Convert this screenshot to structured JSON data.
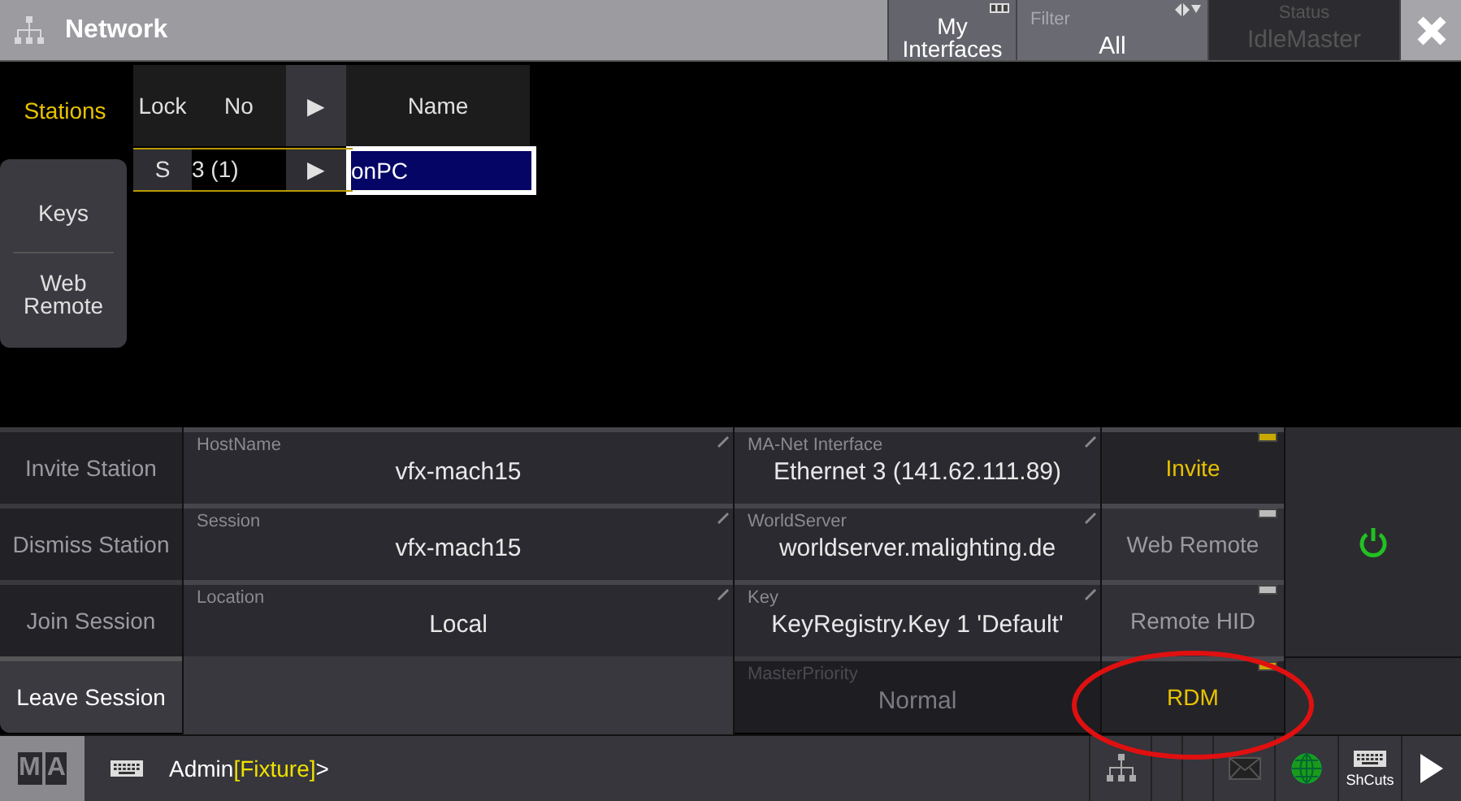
{
  "window": {
    "title": "Network"
  },
  "interfaces_button": {
    "text": "My Interfaces"
  },
  "header_buttons": [
    {
      "kind": "select",
      "label": "Filter",
      "value": "All",
      "disabled": false
    },
    {
      "kind": "select",
      "label": "Status",
      "value": "IdleMaster",
      "disabled": true
    }
  ],
  "tabs": [
    {
      "label": "Stations",
      "selected": true
    },
    {
      "label": "Keys",
      "selected": false
    },
    {
      "label": "Web Remote",
      "selected": false
    }
  ],
  "table": {
    "columns": [
      "Lock",
      "No",
      "▶",
      "Name"
    ],
    "rows": [
      {
        "cells": [
          "S",
          "3 (1)",
          "▶",
          "onPC"
        ],
        "editing": true
      }
    ]
  },
  "actions": [
    {
      "label": "Invite Station",
      "selected": false
    },
    {
      "label": "Dismiss Station",
      "selected": false
    },
    {
      "label": "Join Session",
      "selected": false
    },
    {
      "label": "Leave Session",
      "selected": true
    }
  ],
  "fields_left": [
    {
      "label": "HostName",
      "value": "vfx-mach15",
      "disabled": false
    },
    {
      "label": "Session",
      "value": "vfx-mach15",
      "disabled": false
    },
    {
      "label": "Location",
      "value": "Local",
      "disabled": false
    }
  ],
  "fields_right": [
    {
      "label": "MA-Net Interface",
      "value": "Ethernet 3 (141.62.111.89)",
      "disabled": false
    },
    {
      "label": "WorldServer",
      "value": "worldserver.malighting.de",
      "disabled": false
    },
    {
      "label": "Key",
      "value": "KeyRegistry.Key 1 'Default'",
      "disabled": false
    },
    {
      "label": "MasterPriority",
      "value": "Normal",
      "disabled": true
    }
  ],
  "toggles": [
    {
      "label": "Invite",
      "on": true,
      "highlighted": false
    },
    {
      "label": "Web Remote",
      "on": false,
      "highlighted": false
    },
    {
      "label": "Remote HID",
      "on": false,
      "highlighted": false
    },
    {
      "label": "RDM",
      "on": true,
      "highlighted": true
    }
  ],
  "power": {
    "on": true
  },
  "command_line": {
    "logo": [
      "M",
      "A"
    ],
    "prompt": [
      {
        "text": "Admin",
        "kind": "normal"
      },
      {
        "text": "[Fixture]",
        "kind": "object"
      },
      {
        "text": ">",
        "kind": "normal"
      }
    ]
  },
  "status_bar": [
    {
      "kind": "network"
    },
    {
      "kind": "blank"
    },
    {
      "kind": "blank"
    },
    {
      "kind": "mail"
    },
    {
      "kind": "globe"
    },
    {
      "kind": "shortcuts",
      "label": "ShCuts"
    },
    {
      "kind": "play"
    }
  ]
}
